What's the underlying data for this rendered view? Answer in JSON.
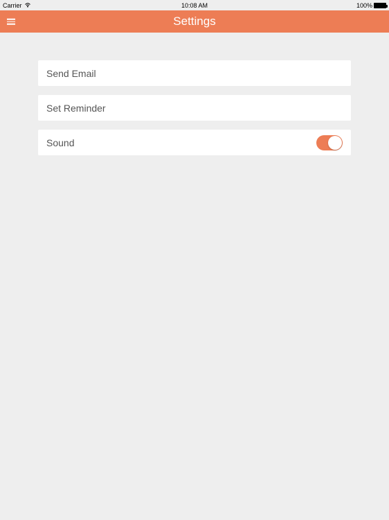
{
  "statusBar": {
    "carrier": "Carrier",
    "time": "10:08 AM",
    "battery": "100%"
  },
  "header": {
    "title": "Settings"
  },
  "settings": {
    "items": [
      {
        "label": "Send Email"
      },
      {
        "label": "Set Reminder"
      },
      {
        "label": "Sound",
        "toggle": true
      }
    ]
  }
}
